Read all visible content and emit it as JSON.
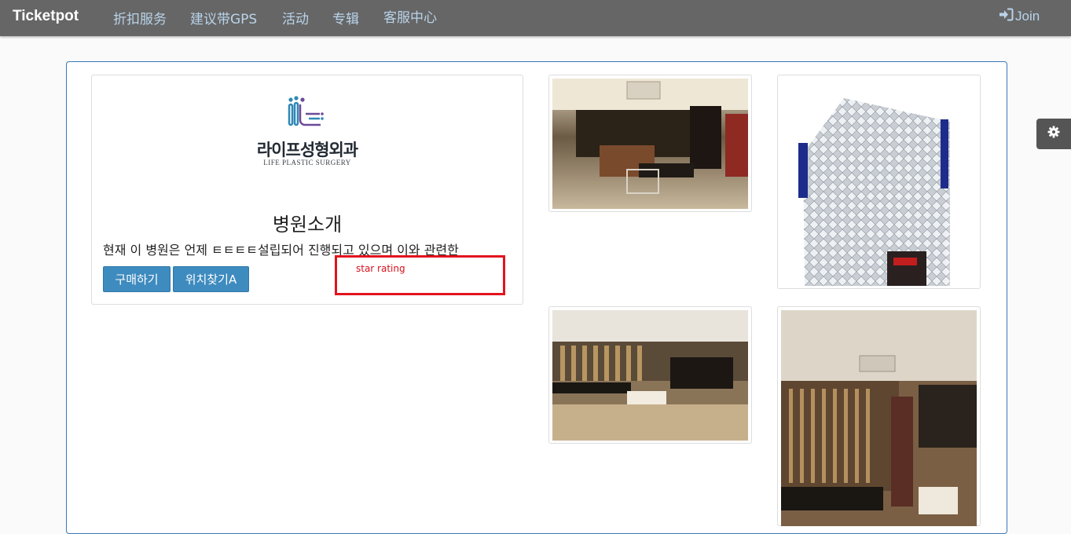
{
  "navbar": {
    "brand": "Ticketpot",
    "links": [
      "折扣服务",
      "建议带GPS",
      "活动",
      "专辑",
      "客服中心"
    ],
    "join_label": "Join"
  },
  "card": {
    "logo_korean": "라이프성형외과",
    "logo_english": "LIFE PLASTIC SURGERY",
    "title": "병원소개",
    "description": "현재 이 병원은 언제 ㅌㅌㅌㅌ설립되어 진행되고 있으며 이와 관련한",
    "buttons": [
      "구매하기",
      "위치찾기A"
    ],
    "star_rating_label": "star rating"
  },
  "colors": {
    "navbar_bg": "#666666",
    "nav_link": "#b9d3ea",
    "button_bg": "#3e8bbf",
    "container_border": "#3a78b8",
    "annotation_red": "#e2141e"
  },
  "icons": {
    "join": "sign-in-icon",
    "settings": "gear-icon"
  }
}
